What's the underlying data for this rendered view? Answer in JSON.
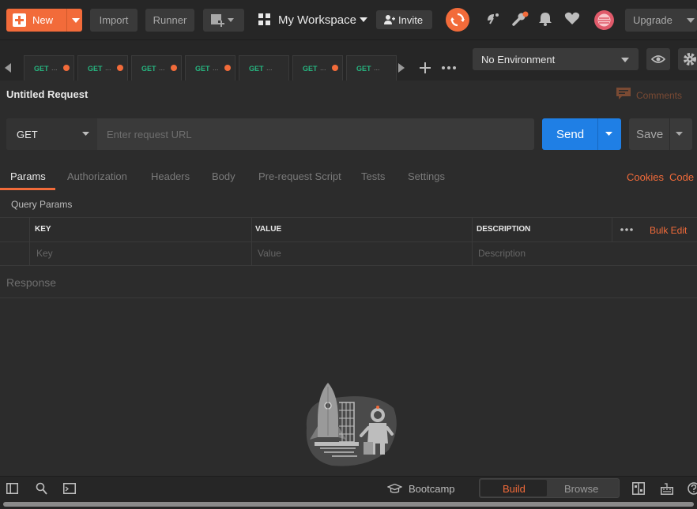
{
  "topbar": {
    "new_label": "New",
    "import_label": "Import",
    "runner_label": "Runner",
    "workspace_name": "My Workspace",
    "invite_label": "Invite",
    "upgrade_label": "Upgrade"
  },
  "tabs": [
    {
      "method": "GET",
      "dirty": true
    },
    {
      "method": "GET",
      "dirty": true
    },
    {
      "method": "GET",
      "dirty": true
    },
    {
      "method": "GET",
      "dirty": true
    },
    {
      "method": "GET",
      "dirty": false
    },
    {
      "method": "GET",
      "dirty": true
    },
    {
      "method": "GET",
      "dirty": false
    }
  ],
  "tab_ellipsis": "...",
  "environment": {
    "selected": "No Environment"
  },
  "request": {
    "title": "Untitled Request",
    "comments_label": "Comments",
    "method": "GET",
    "url_placeholder": "Enter request URL",
    "send_label": "Send",
    "save_label": "Save"
  },
  "subtabs": {
    "params": "Params",
    "authorization": "Authorization",
    "headers": "Headers",
    "body": "Body",
    "prerequest": "Pre-request Script",
    "tests": "Tests",
    "settings": "Settings",
    "cookies": "Cookies",
    "code": "Code"
  },
  "params": {
    "section_label": "Query Params",
    "columns": {
      "key": "KEY",
      "value": "VALUE",
      "description": "DESCRIPTION"
    },
    "bulk_edit": "Bulk Edit",
    "placeholders": {
      "key": "Key",
      "value": "Value",
      "description": "Description"
    }
  },
  "response": {
    "label": "Response"
  },
  "statusbar": {
    "bootcamp_label": "Bootcamp",
    "build_label": "Build",
    "browse_label": "Browse"
  },
  "colors": {
    "accent": "#f26b3a",
    "send": "#1f7fe5",
    "get_method": "#26b47f"
  }
}
